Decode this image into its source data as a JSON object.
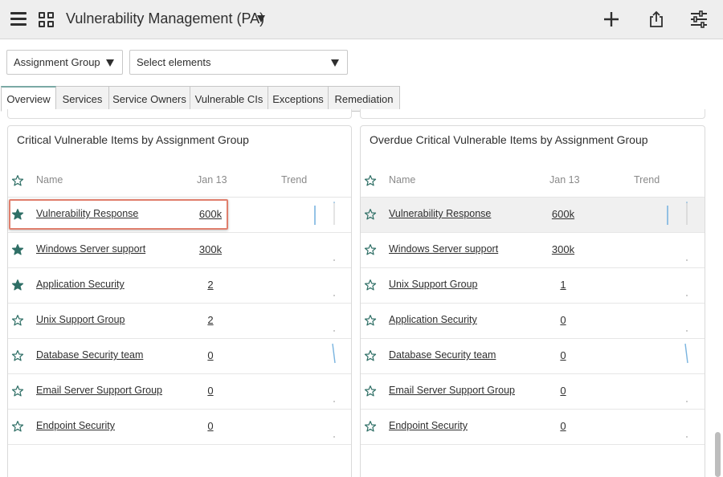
{
  "header": {
    "title": "Vulnerability Management (PA)",
    "icons": [
      "menu-icon",
      "dashboards-icon",
      "chevron-down-icon",
      "plus-icon",
      "share-icon",
      "sliders-icon"
    ]
  },
  "filters": {
    "assignment_group": "Assignment Group",
    "elements_placeholder": "Select elements"
  },
  "tabs": [
    {
      "label": "Overview",
      "active": true
    },
    {
      "label": "Services",
      "active": false
    },
    {
      "label": "Service Owners",
      "active": false
    },
    {
      "label": "Vulnerable CIs",
      "active": false
    },
    {
      "label": "Exceptions",
      "active": false
    },
    {
      "label": "Remediation",
      "active": false
    }
  ],
  "colors": {
    "accent": "#2f6f66",
    "trend": "#7ab4e0",
    "highlight_border": "#e07f6d"
  },
  "cards": [
    {
      "title": "Critical Vulnerable Items by Assignment Group",
      "columns": {
        "name": "Name",
        "date": "Jan 13",
        "trend": "Trend"
      },
      "rows": [
        {
          "name": "Vulnerability Response",
          "value": "600k",
          "starred": true,
          "trend": "up-bar"
        },
        {
          "name": "Windows Server support",
          "value": "300k",
          "starred": true,
          "trend": "dash"
        },
        {
          "name": "Application Security",
          "value": "2",
          "starred": true,
          "trend": "dash"
        },
        {
          "name": "Unix Support Group",
          "value": "2",
          "starred": false,
          "trend": "dash"
        },
        {
          "name": "Database Security team",
          "value": "0",
          "starred": false,
          "trend": "slope"
        },
        {
          "name": "Email Server Support Group",
          "value": "0",
          "starred": false,
          "trend": "dash"
        },
        {
          "name": "Endpoint Security",
          "value": "0",
          "starred": false,
          "trend": "dash"
        }
      ]
    },
    {
      "title": "Overdue Critical Vulnerable Items by Assignment Group",
      "columns": {
        "name": "Name",
        "date": "Jan 13",
        "trend": "Trend"
      },
      "rows": [
        {
          "name": "Vulnerability Response",
          "value": "600k",
          "starred": false,
          "trend": "up-bar"
        },
        {
          "name": "Windows Server support",
          "value": "300k",
          "starred": false,
          "trend": "dash"
        },
        {
          "name": "Unix Support Group",
          "value": "1",
          "starred": false,
          "trend": "dash"
        },
        {
          "name": "Application Security",
          "value": "0",
          "starred": false,
          "trend": "dash"
        },
        {
          "name": "Database Security team",
          "value": "0",
          "starred": false,
          "trend": "slope"
        },
        {
          "name": "Email Server Support Group",
          "value": "0",
          "starred": false,
          "trend": "dash"
        },
        {
          "name": "Endpoint Security",
          "value": "0",
          "starred": false,
          "trend": "dash"
        }
      ]
    }
  ]
}
